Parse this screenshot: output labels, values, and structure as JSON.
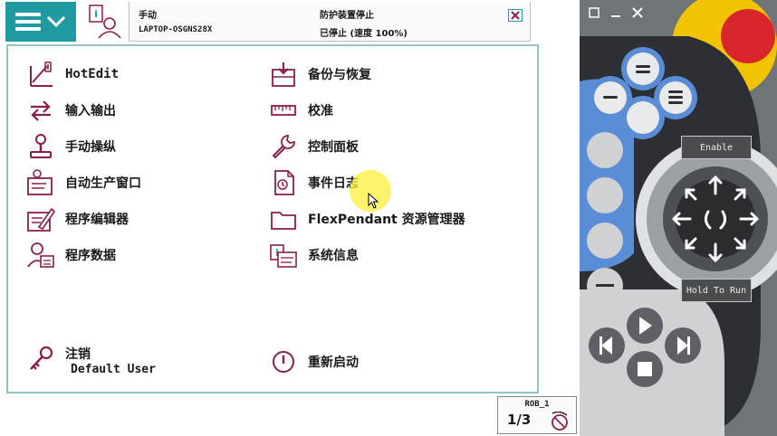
{
  "status": {
    "mode": "手动",
    "host": "LAPTOP-OSGNS28X",
    "state": "防护装置停止",
    "speed": "已停止 (速度 100%)"
  },
  "menu": {
    "left": [
      {
        "label": "HotEdit",
        "icon": "hotedit-icon"
      },
      {
        "label": "输入输出",
        "icon": "io-arrows-icon"
      },
      {
        "label": "手动操纵",
        "icon": "joystick-icon"
      },
      {
        "label": "自动生产窗口",
        "icon": "production-window-icon"
      },
      {
        "label": "程序编辑器",
        "icon": "program-editor-icon"
      },
      {
        "label": "程序数据",
        "icon": "program-data-icon"
      }
    ],
    "right": [
      {
        "label": "备份与恢复",
        "icon": "backup-icon"
      },
      {
        "label": "校准",
        "icon": "calibration-ruler-icon"
      },
      {
        "label": "控制面板",
        "icon": "wrench-icon"
      },
      {
        "label": "事件日志",
        "icon": "event-log-icon"
      },
      {
        "label": "FlexPendant 资源管理器",
        "icon": "folder-icon"
      },
      {
        "label": "系统信息",
        "icon": "system-info-icon"
      }
    ],
    "logout_label": "注销",
    "logout_user": "Default User",
    "restart_label": "重新启动"
  },
  "taskbar": {
    "rob_label": "ROB_1",
    "speed_fraction": "1/3"
  },
  "pendant": {
    "enable_label": "Enable",
    "hold_to_run_label": "Hold To Run"
  },
  "colors": {
    "accent": "#1f9aa0",
    "icon": "#8a1f4e",
    "pendant_blue": "#5b8dd6",
    "emergency_red": "#d9262c",
    "emergency_yellow": "#f2c300"
  }
}
